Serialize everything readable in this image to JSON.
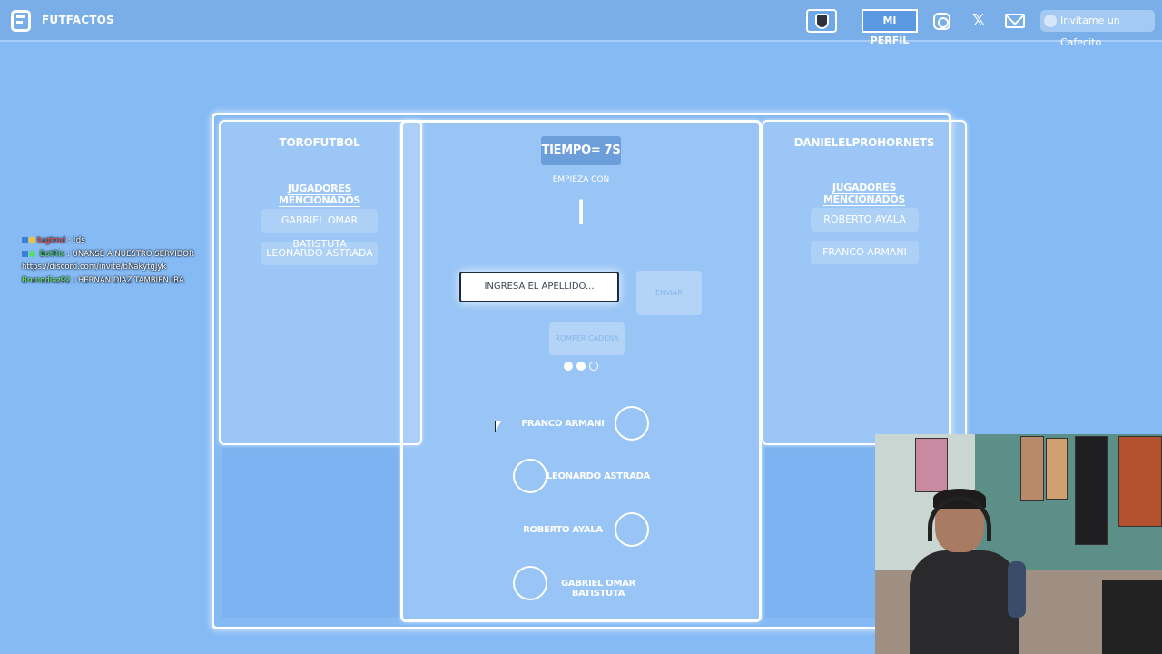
{
  "topbar": {
    "brand": "FUTFACTOS",
    "profile_label": "MI PERFIL",
    "coffee_label": "Invitame un Cafecito",
    "x_label": "𝕏"
  },
  "game": {
    "left_player": {
      "name": "TOROFUTBOL",
      "mentioned_title": "JUGADORES MENCIONADOS",
      "players": [
        "GABRIEL OMAR BATISTUTA",
        "LEONARDO ASTRADA"
      ]
    },
    "right_player": {
      "name": "DANIELELPROHORNETS",
      "mentioned_title": "JUGADORES MENCIONADOS",
      "players": [
        "ROBERTO AYALA",
        "FRANCO ARMANI"
      ]
    },
    "center": {
      "timer": "TIEMPO= 7S",
      "starts_with_label": "EMPIEZA CON",
      "letter": "I",
      "input_placeholder": "INGRESA EL APELLIDO...",
      "send_label": "ENVIAR",
      "break_label": "ROMPER CADENA",
      "lives_filled": 2,
      "lives_total": 3,
      "chain": [
        "FRANCO ARMANI",
        "LEONARDO ASTRADA",
        "ROBERTO AYALA",
        "GABRIEL OMAR BATISTUTA"
      ]
    }
  },
  "chat": [
    {
      "user": "tugtmd",
      "message": ": !ds"
    },
    {
      "user": "BotRix",
      "message": ": UNANSE A NUESTRO SERVIDOR"
    },
    {
      "user": "",
      "message": "https://discord.com/invite/bNakytgJyk"
    },
    {
      "user": "Brunodiaz92",
      "message": ": HERNAN DIAZ TAMBIEN IBA"
    }
  ],
  "colors": {
    "background": "#85baf5",
    "topbar": "#7aaee9",
    "accent_dark": "#5b99e2"
  }
}
